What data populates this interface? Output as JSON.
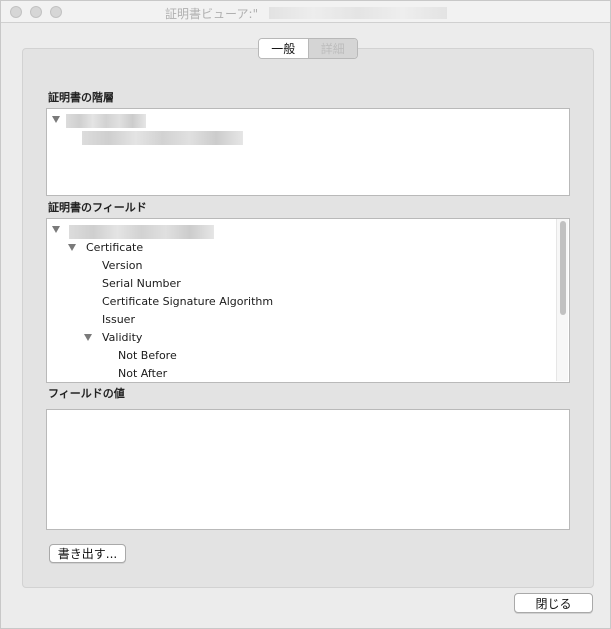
{
  "window": {
    "title": "証明書ビューア:\""
  },
  "tabs": [
    {
      "label": "一般",
      "active": true
    },
    {
      "label": "詳細",
      "active": false
    }
  ],
  "hierarchy": {
    "label": "証明書の階層"
  },
  "fields": {
    "label": "証明書のフィールド",
    "rows": [
      {
        "text": "Certificate"
      },
      {
        "text": "Version"
      },
      {
        "text": "Serial Number"
      },
      {
        "text": "Certificate Signature Algorithm"
      },
      {
        "text": "Issuer"
      },
      {
        "text": "Validity"
      },
      {
        "text": "Not Before"
      },
      {
        "text": "Not After"
      }
    ]
  },
  "value": {
    "label": "フィールドの値"
  },
  "buttons": {
    "export_label": "書き出す...",
    "close_label": "閉じる"
  },
  "colors": {
    "window_bg": "#ececec",
    "panel_bg": "#e3e3e3"
  },
  "icons": {
    "disclosure": "disclosure-triangle-icon"
  }
}
